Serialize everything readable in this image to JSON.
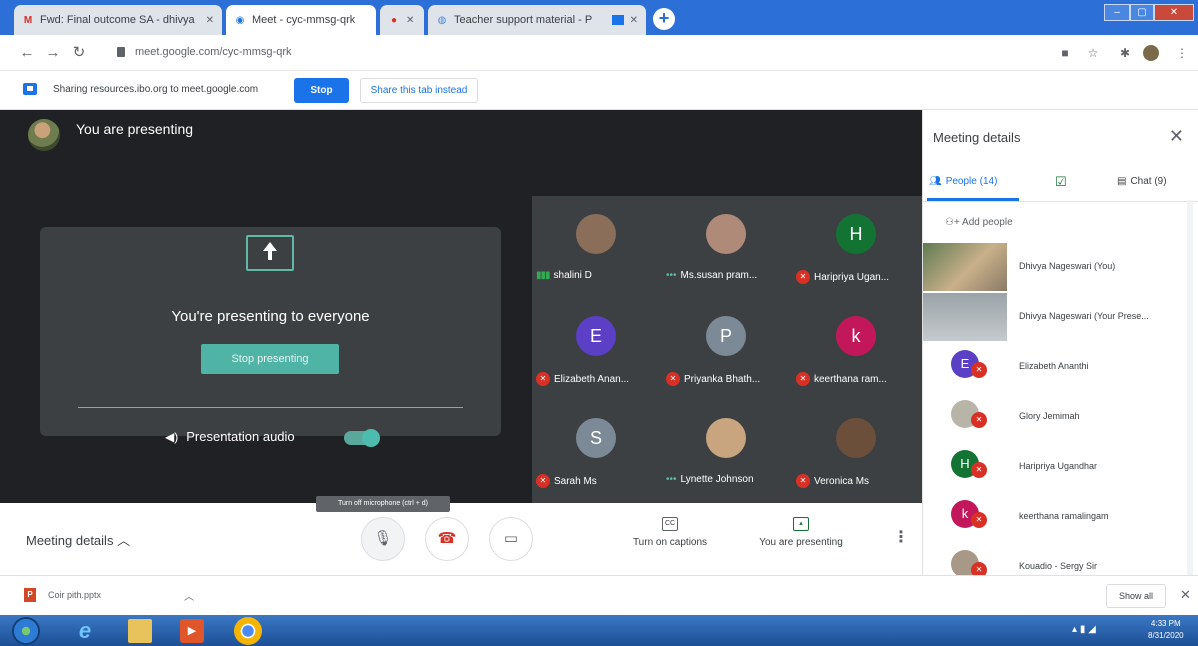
{
  "browser": {
    "tabs": [
      {
        "title": "Fwd: Final outcome SA - dhivya",
        "favicon": "gmail-icon",
        "color": "#d93025"
      },
      {
        "title": "Meet - cyc-mmsg-qrk",
        "favicon": "meet-icon",
        "color": "#1a73e8"
      },
      {
        "title": "",
        "favicon": "recording-icon",
        "color": "#d93025"
      },
      {
        "title": "Teacher support material - P",
        "favicon": "ibo-icon",
        "color": "#4a8ad8"
      }
    ],
    "url": "meet.google.com/cyc-mmsg-qrk"
  },
  "sharebar": {
    "text": "Sharing resources.ibo.org to meet.google.com",
    "stop_label": "Stop",
    "share_tab_label": "Share this tab instead"
  },
  "stage": {
    "presenting_label": "You are presenting",
    "present_title": "You're presenting to everyone",
    "stop_presenting_label": "Stop presenting",
    "audio_label": "Presentation audio"
  },
  "grid": [
    {
      "name": "shalini D",
      "initial": "",
      "avatar_color": "#8a6e5a",
      "status": "speaking"
    },
    {
      "name": "Ms.susan pram...",
      "initial": "",
      "avatar_color": "#b08a78",
      "status": "dots"
    },
    {
      "name": "Haripriya Ugan...",
      "initial": "H",
      "avatar_color": "#137333",
      "status": "muted"
    },
    {
      "name": "Elizabeth Anan...",
      "initial": "E",
      "avatar_color": "#5b3fc4",
      "status": "muted"
    },
    {
      "name": "Priyanka Bhath...",
      "initial": "P",
      "avatar_color": "#7c8a97",
      "status": "muted"
    },
    {
      "name": "keerthana ram...",
      "initial": "k",
      "avatar_color": "#c2185b",
      "status": "muted"
    },
    {
      "name": "Sarah Ms",
      "initial": "S",
      "avatar_color": "#7c8a97",
      "status": "muted"
    },
    {
      "name": "Lynette Johnson",
      "initial": "",
      "avatar_color": "#c9a57f",
      "status": "dots"
    },
    {
      "name": "Veronica Ms",
      "initial": "",
      "avatar_color": "#6b4f3a",
      "status": "muted"
    }
  ],
  "controls": {
    "meeting_details_label": "Meeting details",
    "tooltip": "Turn off microphone (ctrl + d)",
    "captions_label": "Turn on captions",
    "presenting_label": "You are presenting"
  },
  "panel": {
    "title": "Meeting details",
    "people_tab": "People (14)",
    "chat_tab": "Chat (9)",
    "add_people": "Add people",
    "people": [
      {
        "name": "Dhivya Nageswari (You)",
        "type": "thumb",
        "initial": ""
      },
      {
        "name": "Dhivya Nageswari (Your Prese...",
        "type": "thumb",
        "initial": ""
      },
      {
        "name": "Elizabeth Ananthi",
        "type": "avatar",
        "initial": "E",
        "color": "#5b3fc4"
      },
      {
        "name": "Glory Jemimah",
        "type": "avatar",
        "initial": "",
        "color": "#b8b4a8"
      },
      {
        "name": "Haripriya Ugandhar",
        "type": "avatar",
        "initial": "H",
        "color": "#137333"
      },
      {
        "name": "keerthana ramalingam",
        "type": "avatar",
        "initial": "k",
        "color": "#c2185b"
      },
      {
        "name": "Kouadio - Sergy Sir",
        "type": "avatar",
        "initial": "",
        "color": "#a89888"
      }
    ]
  },
  "downloads": {
    "file": "Coir pith.pptx",
    "show_all": "Show all"
  },
  "taskbar": {
    "time": "4:33 PM",
    "date": "8/31/2020"
  }
}
